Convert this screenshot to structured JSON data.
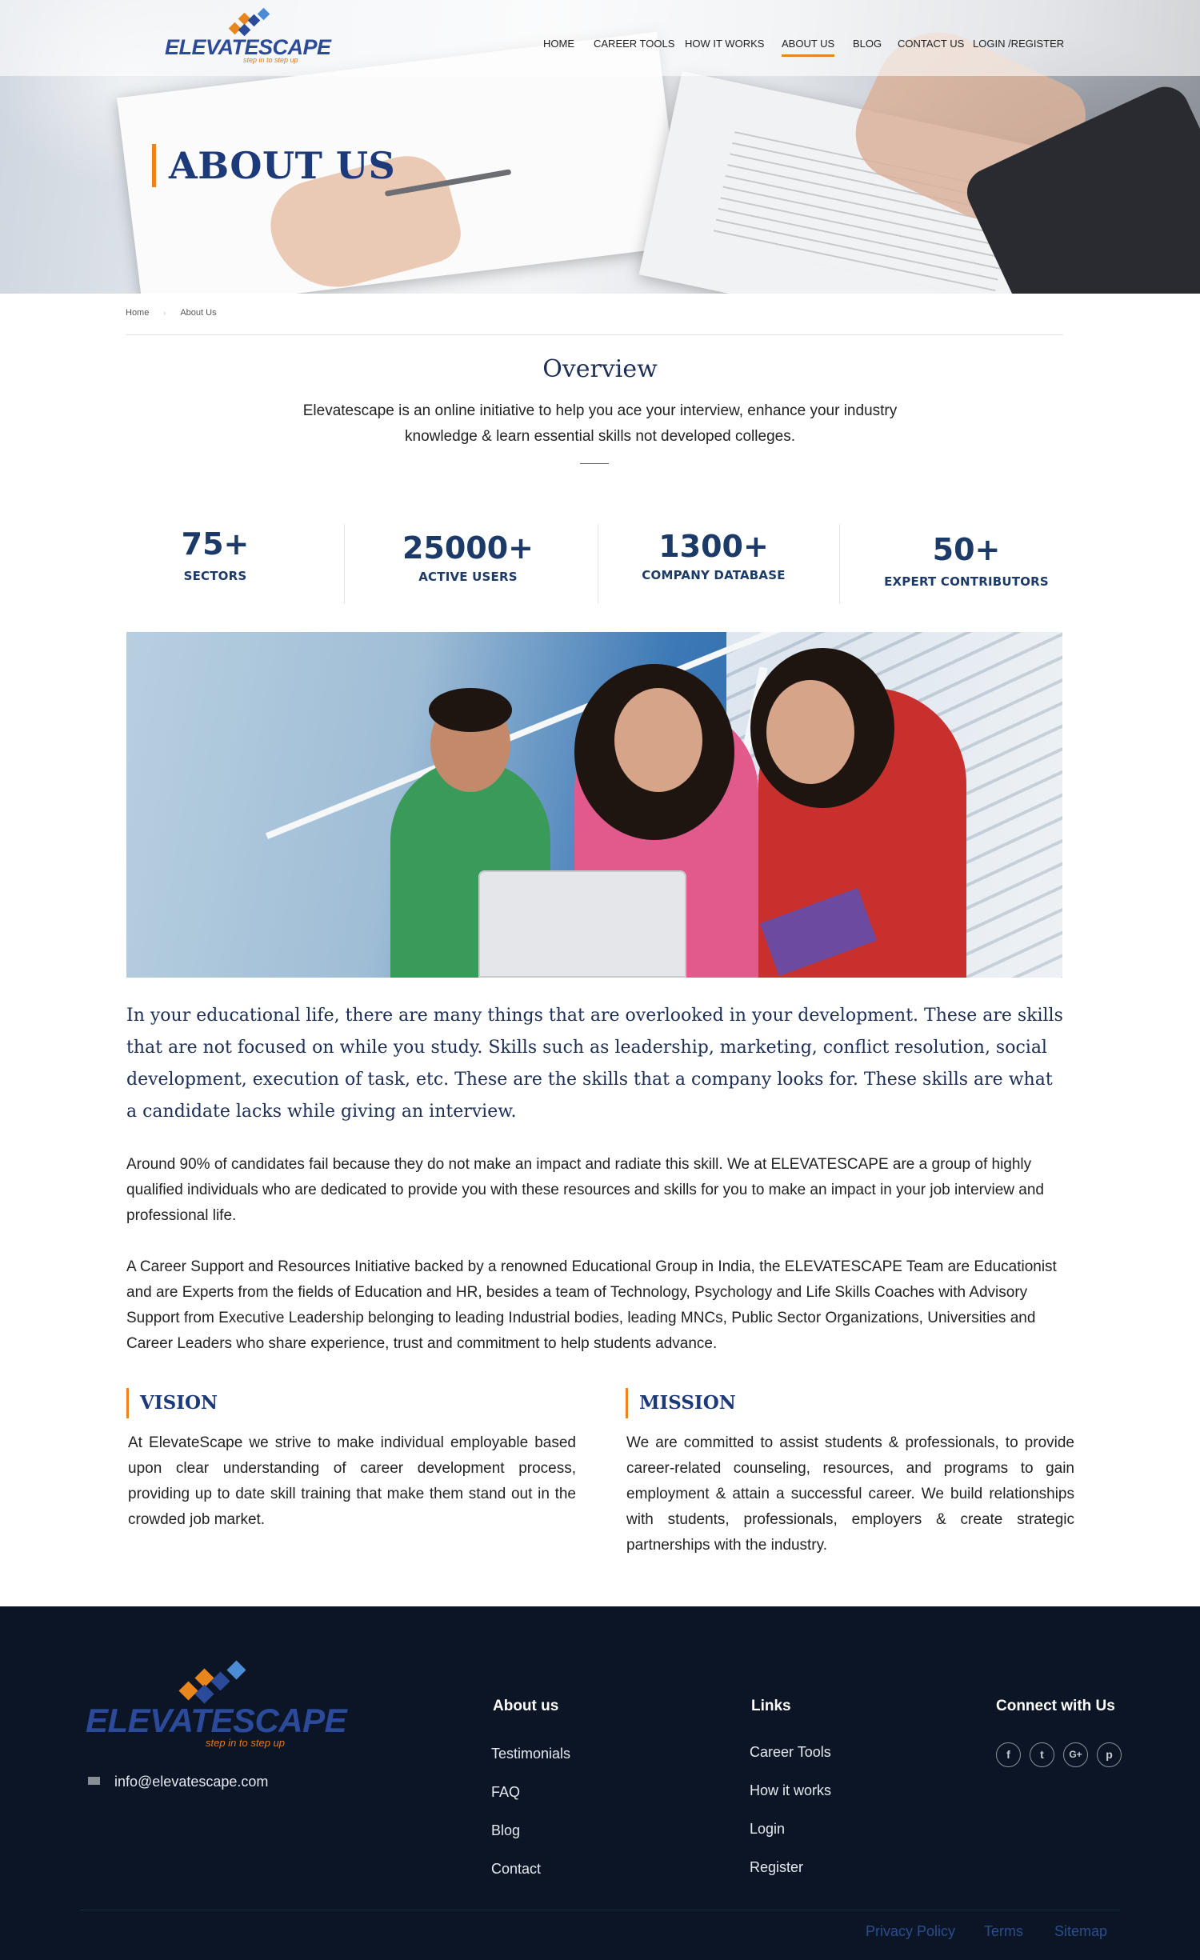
{
  "brand": {
    "name": "ELEVATESCAPE",
    "tagline": "step in to step up",
    "colors": {
      "primary": "#1c3a7a",
      "accent": "#e8861d",
      "footer_bg": "#0b1526"
    }
  },
  "nav": {
    "items": [
      {
        "label": "HOME"
      },
      {
        "label": "CAREER TOOLS"
      },
      {
        "label": "HOW IT WORKS"
      },
      {
        "label": "ABOUT US",
        "active": true
      },
      {
        "label": "BLOG"
      },
      {
        "label": "CONTACT US"
      },
      {
        "label": "LOGIN /REGISTER"
      }
    ]
  },
  "hero": {
    "title": "ABOUT US"
  },
  "breadcrumb": {
    "home": "Home",
    "current": "About Us"
  },
  "overview": {
    "title": "Overview",
    "text": "Elevatescape is an online initiative to help you ace your interview, enhance your industry knowledge & learn essential skills not developed colleges."
  },
  "stats": [
    {
      "value": "75+",
      "label": "SECTORS"
    },
    {
      "value": "25000+",
      "label": "ACTIVE USERS"
    },
    {
      "value": "1300+",
      "label": "COMPANY DATABASE"
    },
    {
      "value": "50+",
      "label": "EXPERT CONTRIBUTORS"
    }
  ],
  "content": {
    "lead": "In your educational life, there are many things that are overlooked in your development. These are skills that are not focused on while you study. Skills such as leadership, marketing, conflict resolution, social development, execution of task, etc. These are the skills that a company looks for. These skills are what a candidate lacks while giving an interview.",
    "para1": "Around 90% of candidates fail because they do not make an impact and radiate this skill. We at ELEVATESCAPE are a group of highly qualified individuals who are dedicated to provide you with these resources and skills for you to make an impact in your job interview and professional life.",
    "para2": "A Career Support and Resources Initiative backed by a renowned Educational Group in India, the ELEVATESCAPE Team are Educationist and are Experts from the fields of Education and HR, besides a team of  Technology, Psychology and Life Skills Coaches with Advisory Support from Executive Leadership belonging to leading Industrial bodies, leading MNCs, Public Sector Organizations, Universities and Career Leaders who share experience, trust and commitment to help students advance."
  },
  "vision": {
    "title": "VISION",
    "text": "At ElevateScape we strive to make individual employable based upon clear understanding of career development process, providing up to date skill training that make them stand out in the crowded job market."
  },
  "mission": {
    "title": "MISSION",
    "text": "We are committed to assist students & professionals, to provide career-related counseling, resources, and programs to gain employment & attain a successful career. We build relationships with students, professionals, employers & create strategic partnerships with the industry."
  },
  "footer": {
    "email": "info@elevatescape.com",
    "about": {
      "heading": "About us",
      "links": [
        "Testimonials",
        "FAQ",
        "Blog",
        "Contact"
      ]
    },
    "links": {
      "heading": "Links",
      "links": [
        "Career Tools",
        "How it works",
        "Login",
        "Register"
      ]
    },
    "connect": {
      "heading": "Connect with Us",
      "icons": [
        {
          "name": "facebook-icon",
          "glyph": "f"
        },
        {
          "name": "twitter-icon",
          "glyph": "t"
        },
        {
          "name": "google-plus-icon",
          "glyph": "G+"
        },
        {
          "name": "pinterest-icon",
          "glyph": "p"
        }
      ]
    },
    "bottom": [
      "Privacy Policy",
      "Terms",
      "Sitemap"
    ]
  }
}
